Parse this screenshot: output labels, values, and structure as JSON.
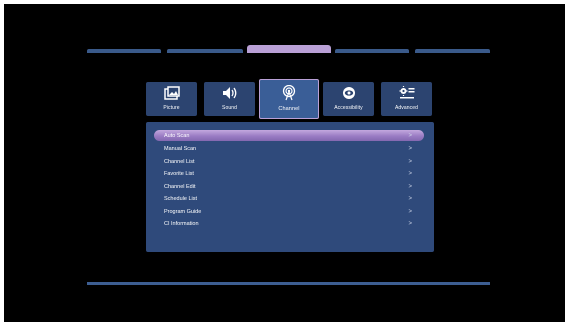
{
  "tabs": [
    {
      "label": "Picture",
      "icon": "picture-icon"
    },
    {
      "label": "Sound",
      "icon": "speaker-icon"
    },
    {
      "label": "Channel",
      "icon": "antenna-icon",
      "active": true
    },
    {
      "label": "Accessibility",
      "icon": "eye-icon"
    },
    {
      "label": "Advanced",
      "icon": "settings-sliders-icon"
    }
  ],
  "menu": {
    "chevron": ">",
    "items": [
      {
        "label": "Auto Scan",
        "selected": true
      },
      {
        "label": "Manual Scan"
      },
      {
        "label": "Channel List"
      },
      {
        "label": "Favorite List"
      },
      {
        "label": "Channel Edit"
      },
      {
        "label": "Schedule List"
      },
      {
        "label": "Program Guide"
      },
      {
        "label": "CI Information"
      }
    ]
  },
  "colors": {
    "background": "#000000",
    "panel": "#2f4a7b",
    "tab": "#2c4470",
    "tab_active": "#3a5e97",
    "highlight": "#b9a0d6"
  }
}
